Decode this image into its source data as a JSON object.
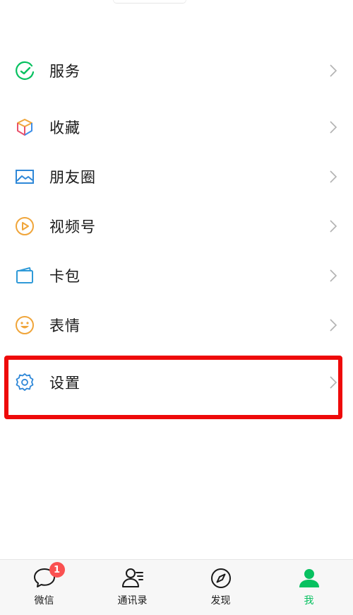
{
  "menu": {
    "items": [
      {
        "label": "服务",
        "icon": "service-icon"
      },
      {
        "label": "收藏",
        "icon": "favorites-icon"
      },
      {
        "label": "朋友圈",
        "icon": "moments-icon"
      },
      {
        "label": "视频号",
        "icon": "channels-icon"
      },
      {
        "label": "卡包",
        "icon": "cards-icon"
      },
      {
        "label": "表情",
        "icon": "stickers-icon"
      },
      {
        "label": "设置",
        "icon": "settings-icon"
      }
    ]
  },
  "tabbar": {
    "tabs": [
      {
        "label": "微信",
        "icon": "chat-bubble-icon",
        "badge": "1"
      },
      {
        "label": "通讯录",
        "icon": "contacts-icon"
      },
      {
        "label": "发现",
        "icon": "compass-icon"
      },
      {
        "label": "我",
        "icon": "person-icon",
        "active": true
      }
    ]
  },
  "colors": {
    "accent_green": "#07c160",
    "highlight_red": "#ee0a0a",
    "badge_red": "#fa5151",
    "chevron_gray": "#b2b2b2"
  }
}
